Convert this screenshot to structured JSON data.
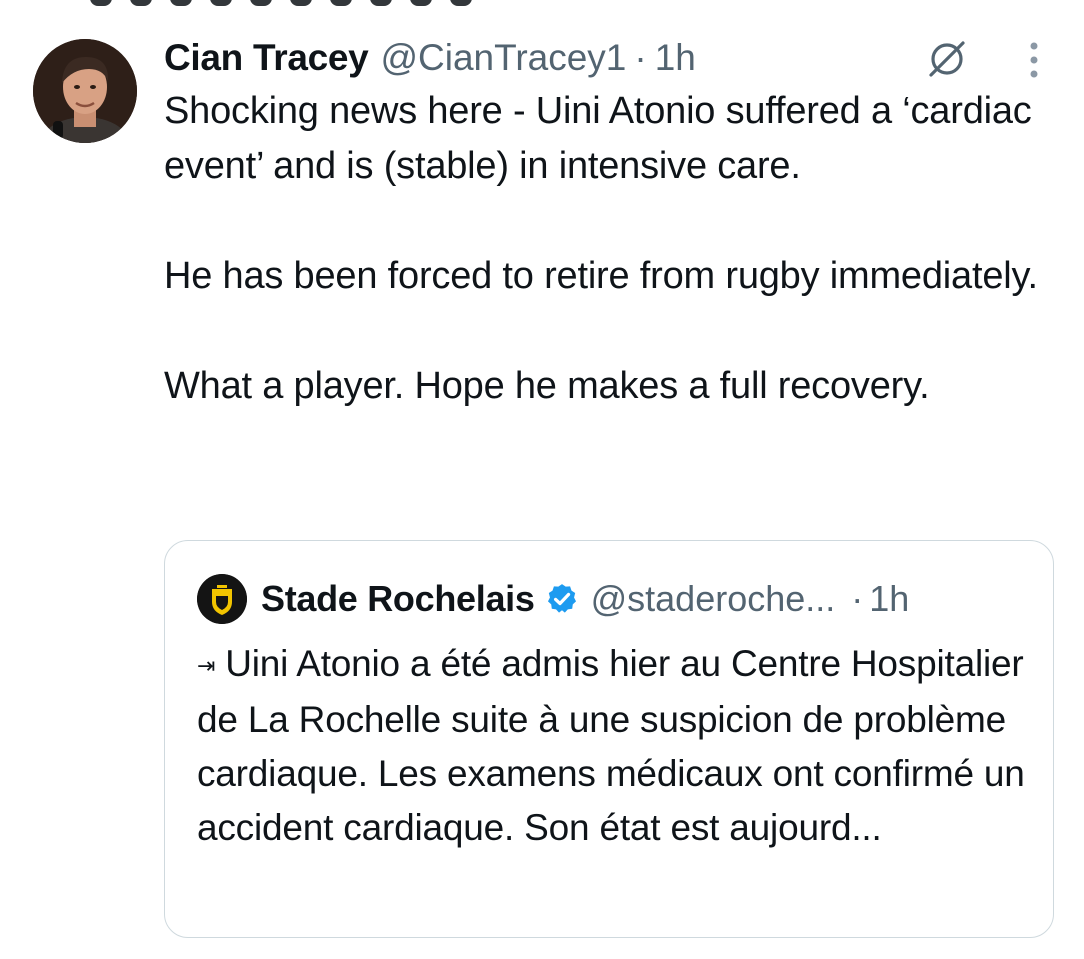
{
  "tweet": {
    "author_name": "Cian Tracey",
    "author_handle": "@CianTracey1",
    "separator": "·",
    "time": "1h",
    "paragraphs": [
      "Shocking news here - Uini Atonio suffered a ‘cardiac event’ and is (stable) in intensive care.",
      "He has been forced to retire from rugby immediately.",
      "What a player. Hope he makes a full recovery."
    ]
  },
  "icons": {
    "grok": "grok-slash-circle-icon",
    "more": "vertical-dots-icon",
    "verified": "verified-badge-icon",
    "arrow": "right-arrow-to-bar-icon"
  },
  "quote": {
    "author_name": "Stade Rochelais",
    "author_handle": "@staderoche...",
    "separator": "·",
    "time": "1h",
    "arrow_glyph": "⇥",
    "text": "Uini Atonio a été admis hier au Centre Hospitalier de La Rochelle suite à une suspicion de problème cardiaque. Les examens médicaux ont confirmé un accident cardiaque. Son état est aujourd..."
  },
  "colors": {
    "text_primary": "#0f1419",
    "text_secondary": "#536471",
    "border": "#cfd9de",
    "verified_blue": "#1d9bf0",
    "logo_yellow": "#f2c400"
  }
}
